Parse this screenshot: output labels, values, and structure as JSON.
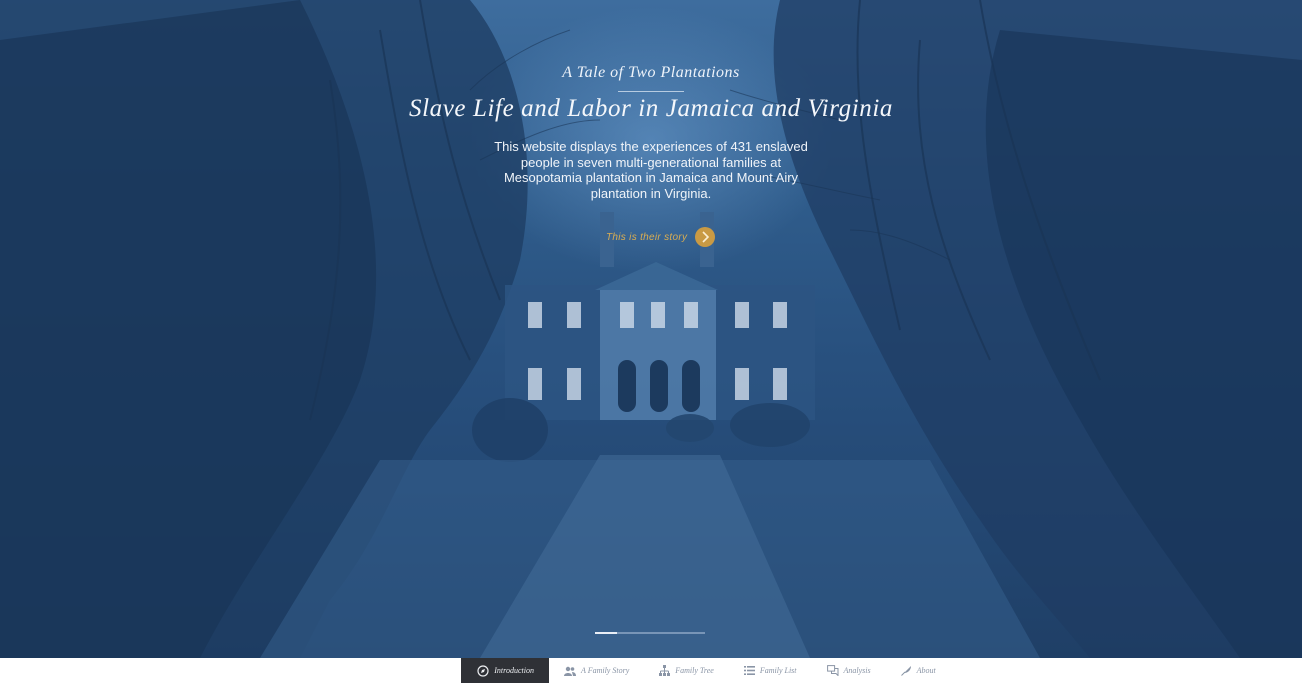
{
  "hero": {
    "subtitle": "A Tale of Two Plantations",
    "title": "Slave Life and Labor in Jamaica and Virginia",
    "intro": "This website displays the experiences of 431 enslaved people in seven multi-generational families at Mesopotamia plantation in Jamaica and Mount Airy plantation in Virginia.",
    "cta_label": "This is their story",
    "cta_icon": "chevron-right-icon",
    "accent_color": "#c99a44",
    "tint_color": "#2f5c8b"
  },
  "slider": {
    "count": 5,
    "active_index": 0
  },
  "nav": {
    "items": [
      {
        "label": "Introduction",
        "icon": "compass-icon",
        "active": true
      },
      {
        "label": "A Family Story",
        "icon": "people-icon",
        "active": false
      },
      {
        "label": "Family Tree",
        "icon": "tree-icon",
        "active": false
      },
      {
        "label": "Family List",
        "icon": "list-icon",
        "active": false
      },
      {
        "label": "Analysis",
        "icon": "chat-icon",
        "active": false
      },
      {
        "label": "About",
        "icon": "feather-icon",
        "active": false
      }
    ]
  }
}
